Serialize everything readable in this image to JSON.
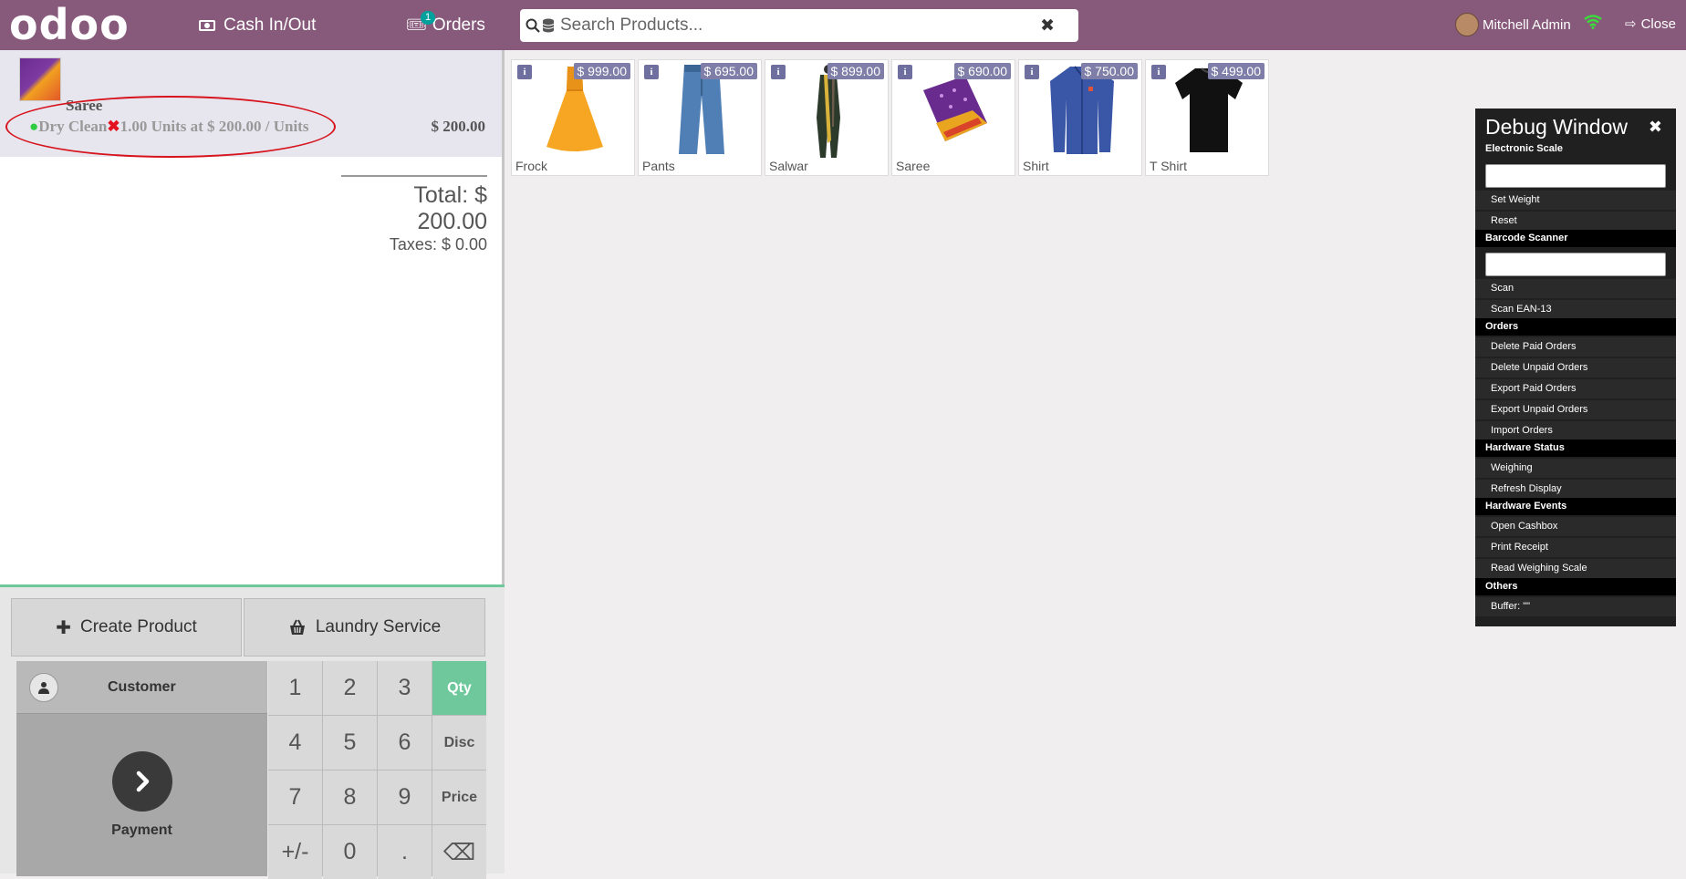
{
  "topbar": {
    "logo": "odoo",
    "cash_label": "Cash In/Out",
    "orders_label": "Orders",
    "orders_count": "1",
    "search_placeholder": "Search Products...",
    "user_name": "Mitchell Admin",
    "close_label": "Close"
  },
  "order": {
    "line": {
      "product": "Saree",
      "service": "Dry Clean",
      "quantity_text": "1.00 Units at $ 200.00 / Units",
      "price": "$ 200.00"
    },
    "total": "Total: $ 200.00",
    "taxes": "Taxes: $ 0.00"
  },
  "controls": {
    "create_product": "Create Product",
    "laundry_service": "Laundry Service",
    "customer": "Customer",
    "payment": "Payment",
    "keys": [
      "1",
      "2",
      "3",
      "Qty",
      "4",
      "5",
      "6",
      "Disc",
      "7",
      "8",
      "9",
      "Price",
      "+/-",
      "0",
      ".",
      "⌫"
    ]
  },
  "products": [
    {
      "name": "Frock",
      "price": "$ 999.00",
      "icon": "frock-image"
    },
    {
      "name": "Pants",
      "price": "$ 695.00",
      "icon": "pants-image"
    },
    {
      "name": "Salwar",
      "price": "$ 899.00",
      "icon": "salwar-image"
    },
    {
      "name": "Saree",
      "price": "$ 690.00",
      "icon": "saree-image"
    },
    {
      "name": "Shirt",
      "price": "$ 750.00",
      "icon": "shirt-image"
    },
    {
      "name": "T Shirt",
      "price": "$ 499.00",
      "icon": "tshirt-image"
    }
  ],
  "debug": {
    "title": "Debug Window",
    "sections": {
      "electronic_scale": "Electronic Scale",
      "barcode_scanner": "Barcode Scanner",
      "orders": "Orders",
      "hardware_status": "Hardware Status",
      "hardware_events": "Hardware Events",
      "others": "Others"
    },
    "items": {
      "set_weight": "Set Weight",
      "reset": "Reset",
      "scan": "Scan",
      "scan_ean13": "Scan EAN-13",
      "delete_paid": "Delete Paid Orders",
      "delete_unpaid": "Delete Unpaid Orders",
      "export_paid": "Export Paid Orders",
      "export_unpaid": "Export Unpaid Orders",
      "import_orders": "Import Orders",
      "weighing": "Weighing",
      "refresh_display": "Refresh Display",
      "open_cashbox": "Open Cashbox",
      "print_receipt": "Print Receipt",
      "read_weighing_scale": "Read Weighing Scale",
      "buffer": "Buffer: \"\""
    }
  },
  "colors": {
    "topbar": "#875a7b",
    "accent": "#6ec89b",
    "badge": "#00a09d",
    "highlight": "#d7141d"
  }
}
